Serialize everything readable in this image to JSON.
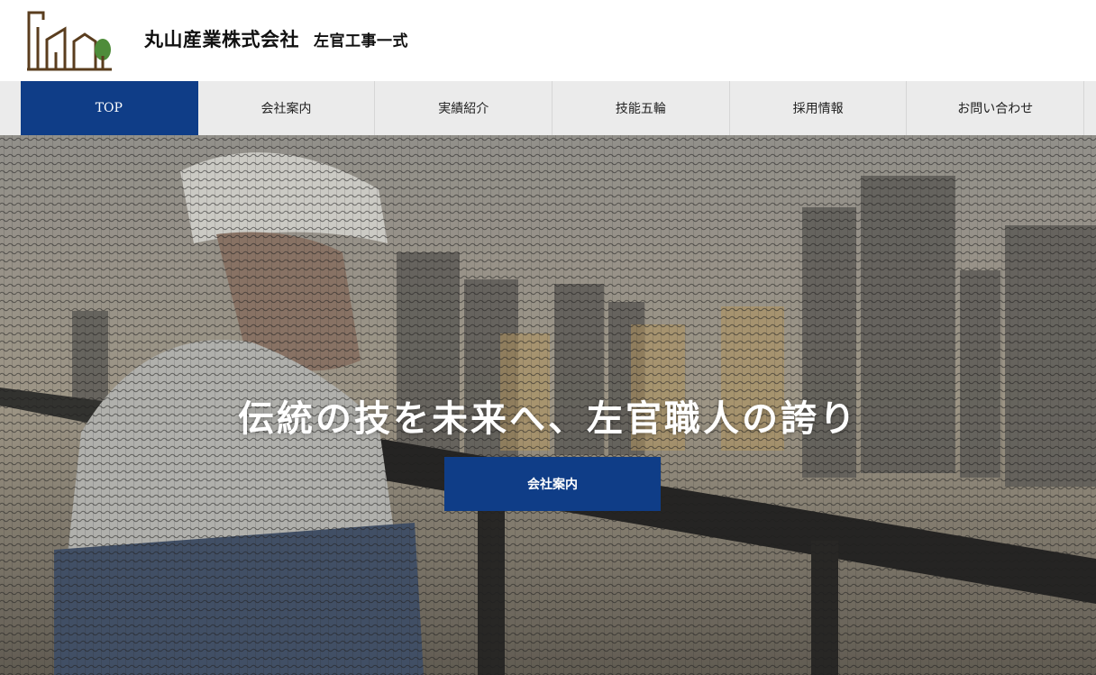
{
  "header": {
    "company_name": "丸山産業株式会社",
    "tagline": "左官工事一式",
    "logo_icon": "house-tree-logo-icon",
    "colors": {
      "logo_brown": "#5a3d1e",
      "logo_green": "#4e8c3a"
    }
  },
  "nav": {
    "active_color": "#0f3d87",
    "items": [
      {
        "label": "TOP",
        "active": true
      },
      {
        "label": "会社案内",
        "active": false
      },
      {
        "label": "実績紹介",
        "active": false
      },
      {
        "label": "技能五輪",
        "active": false
      },
      {
        "label": "採用情報",
        "active": false
      },
      {
        "label": "お問い合わせ",
        "active": false
      }
    ]
  },
  "hero": {
    "title": "伝統の技を未来へ、左官職人の誇り",
    "cta_label": "会社案内",
    "cta_color": "#0f3d87"
  }
}
